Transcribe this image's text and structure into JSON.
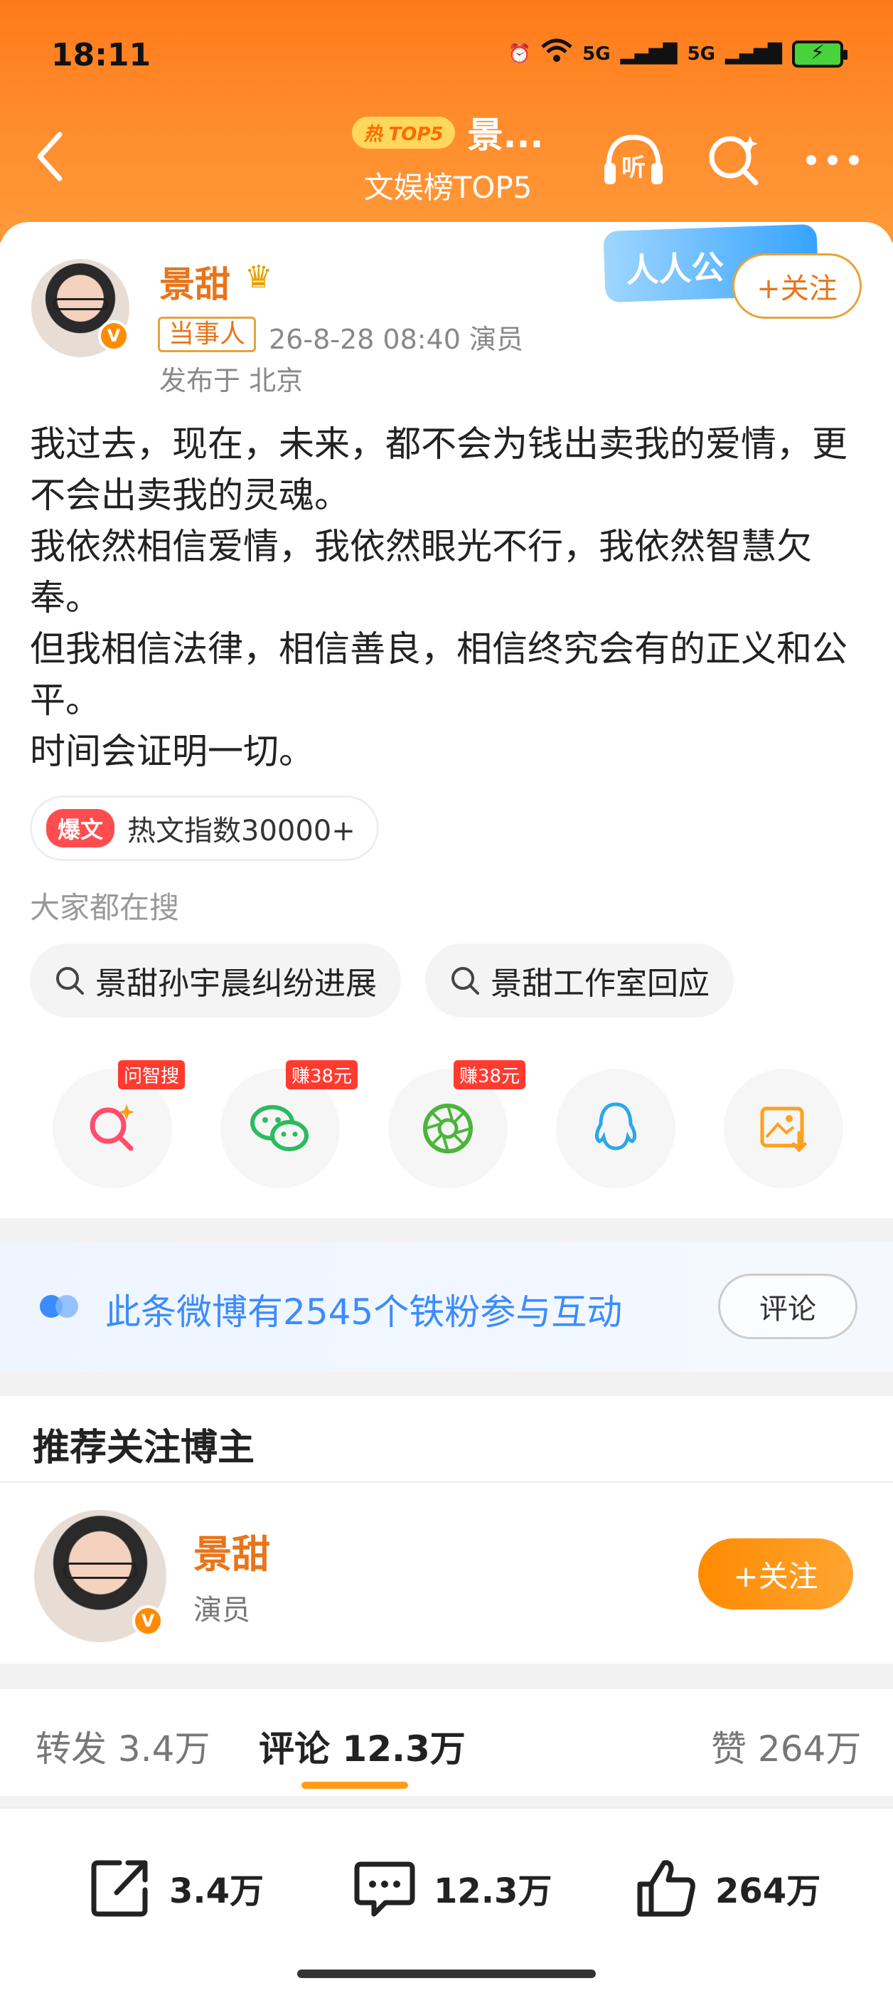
{
  "status_bar": {
    "time": "18:11",
    "net1": "5G",
    "net2": "5G"
  },
  "nav": {
    "badge": "热 TOP5",
    "title": "景...",
    "subtitle": "文娱榜TOP5"
  },
  "post": {
    "author": "景甜",
    "tag": "当事人",
    "meta": "26-8-28 08:40  演员",
    "location": "发布于 北京",
    "banner_text": "人人公",
    "follow_label": "+关注",
    "paragraphs": [
      "我过去，现在，未来，都不会为钱出卖我的爱情，更不会出卖我的灵魂。",
      "我依然相信爱情，我依然眼光不行，我依然智慧欠奉。",
      "但我相信法律，相信善良，相信终究会有的正义和公平。",
      "时间会证明一切。"
    ],
    "hot_badge": "爆文",
    "hot_index": "热文指数30000+"
  },
  "search": {
    "title": "大家都在搜",
    "chips": [
      "景甜孙宇晨纠纷进展",
      "景甜工作室回应"
    ]
  },
  "share": {
    "badges": [
      "问智搜",
      "赚38元",
      "赚38元"
    ]
  },
  "fans": {
    "text": "此条微博有2545个铁粉参与互动",
    "button": "评论"
  },
  "recommend": {
    "title": "推荐关注博主",
    "name": "景甜",
    "role": "演员",
    "follow_label": "+关注"
  },
  "tabs": {
    "repost": "转发 3.4万",
    "comment": "评论 12.3万",
    "like": "赞 264万"
  },
  "bottom_bar": {
    "repost": "3.4万",
    "comment": "12.3万",
    "like": "264万"
  },
  "colors": {
    "accent": "#ff8a2a",
    "orange_text": "#e8751a",
    "blue": "#3b8cff"
  }
}
